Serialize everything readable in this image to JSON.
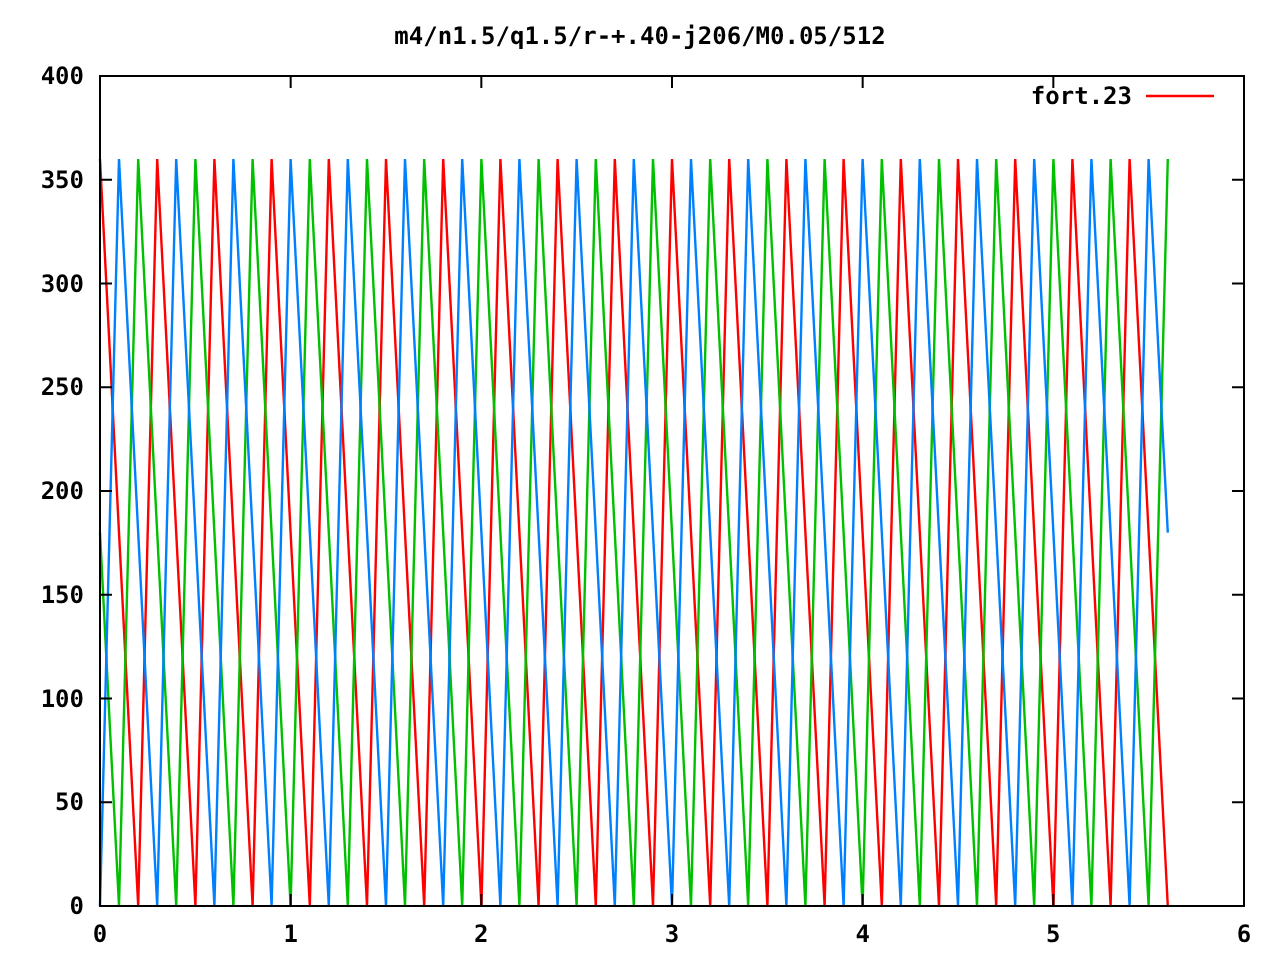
{
  "plot": {
    "chart_data": {
      "type": "line",
      "title": "m4/n1.5/q1.5/r-+.40-j206/M0.05/512",
      "xlim": [
        0,
        6
      ],
      "ylim": [
        0,
        400
      ],
      "xticks": [
        0,
        1,
        2,
        3,
        4,
        5,
        6
      ],
      "yticks": [
        0,
        50,
        100,
        150,
        200,
        250,
        300,
        350,
        400
      ],
      "x": [
        0,
        0.1,
        0.2,
        0.3,
        0.4,
        0.5,
        0.6,
        0.7,
        0.8,
        0.9,
        1,
        1.1,
        1.2,
        1.3,
        1.4,
        1.5,
        1.6,
        1.7,
        1.8,
        1.9,
        2,
        2.1,
        2.2,
        2.3,
        2.4,
        2.5,
        2.6,
        2.7,
        2.8,
        2.9,
        3,
        3.1,
        3.2,
        3.3,
        3.4,
        3.5,
        3.6,
        3.7,
        3.8,
        3.9,
        4,
        4.1,
        4.2,
        4.3,
        4.4,
        4.5,
        4.6,
        4.7,
        4.8,
        4.9,
        5,
        5.1,
        5.2,
        5.3,
        5.4,
        5.5,
        5.6
      ],
      "series": [
        {
          "name": "fort.23",
          "color": "#ff0000",
          "values": [
            360,
            180,
            0,
            360,
            180,
            0,
            360,
            180,
            0,
            360,
            180,
            0,
            360,
            180,
            0,
            360,
            180,
            0,
            360,
            180,
            0,
            360,
            180,
            0,
            360,
            180,
            0,
            360,
            180,
            0,
            360,
            180,
            0,
            360,
            180,
            0,
            360,
            180,
            0,
            360,
            180,
            0,
            360,
            180,
            0,
            360,
            180,
            0,
            360,
            180,
            0,
            360,
            180,
            0,
            360,
            180,
            0
          ]
        },
        {
          "color": "#00c000",
          "values": [
            180,
            0,
            360,
            180,
            0,
            360,
            180,
            0,
            360,
            180,
            0,
            360,
            180,
            0,
            360,
            180,
            0,
            360,
            180,
            0,
            360,
            180,
            0,
            360,
            180,
            0,
            360,
            180,
            0,
            360,
            180,
            0,
            360,
            180,
            0,
            360,
            180,
            0,
            360,
            180,
            0,
            360,
            180,
            0,
            360,
            180,
            0,
            360,
            180,
            0,
            360,
            180,
            0,
            360,
            180,
            0,
            360
          ]
        },
        {
          "color": "#0080ff",
          "values": [
            0,
            360,
            180,
            0,
            360,
            180,
            0,
            360,
            180,
            0,
            360,
            180,
            0,
            360,
            180,
            0,
            360,
            180,
            0,
            360,
            180,
            0,
            360,
            180,
            0,
            360,
            180,
            0,
            360,
            180,
            0,
            360,
            180,
            0,
            360,
            180,
            0,
            360,
            180,
            0,
            360,
            180,
            0,
            360,
            180,
            0,
            360,
            180,
            0,
            360,
            180,
            0,
            360,
            180,
            0,
            360,
            180
          ]
        }
      ]
    }
  }
}
